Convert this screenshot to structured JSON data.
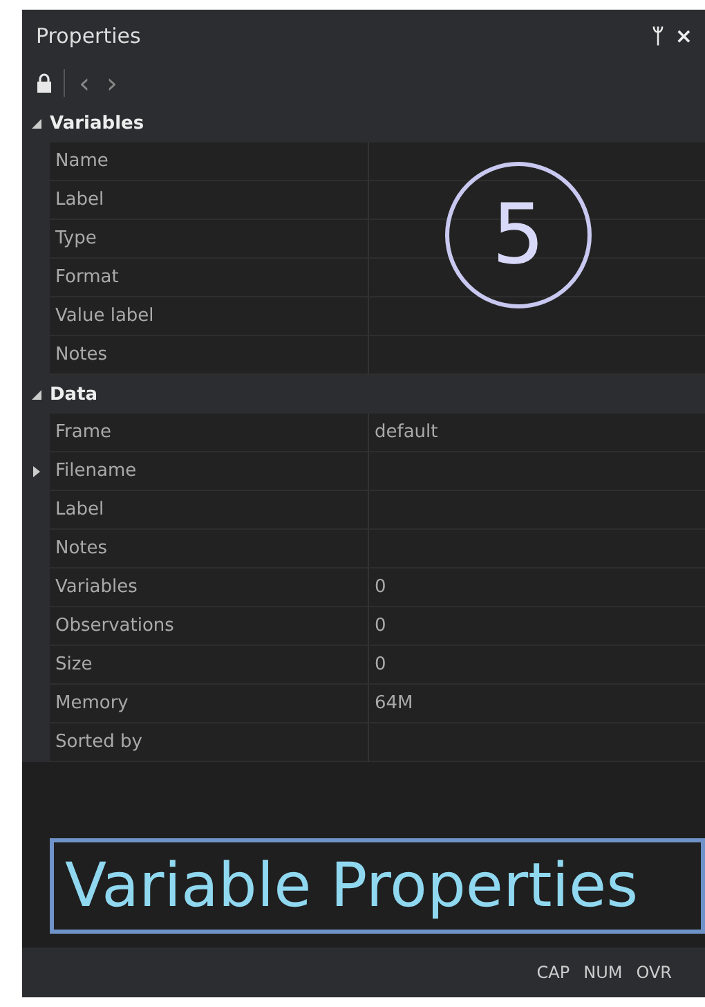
{
  "panel": {
    "title": "Properties",
    "pin": "ᛘ",
    "close": "×"
  },
  "toolbar": {
    "locked": true,
    "back": "‹",
    "forward": "›"
  },
  "groups": [
    {
      "name": "Variables",
      "expanded": true,
      "rows": [
        {
          "label": "Name",
          "value": "",
          "expandable": false
        },
        {
          "label": "Label",
          "value": "",
          "expandable": false
        },
        {
          "label": "Type",
          "value": "",
          "expandable": false
        },
        {
          "label": "Format",
          "value": "",
          "expandable": false
        },
        {
          "label": "Value label",
          "value": "",
          "expandable": false
        },
        {
          "label": "Notes",
          "value": "",
          "expandable": false
        }
      ]
    },
    {
      "name": "Data",
      "expanded": true,
      "rows": [
        {
          "label": "Frame",
          "value": "default",
          "expandable": false
        },
        {
          "label": "Filename",
          "value": "",
          "expandable": true
        },
        {
          "label": "Label",
          "value": "",
          "expandable": false
        },
        {
          "label": "Notes",
          "value": "",
          "expandable": false
        },
        {
          "label": "Variables",
          "value": "0",
          "expandable": false
        },
        {
          "label": "Observations",
          "value": "0",
          "expandable": false
        },
        {
          "label": "Size",
          "value": "0",
          "expandable": false
        },
        {
          "label": "Memory",
          "value": "64M",
          "expandable": false
        },
        {
          "label": "Sorted by",
          "value": "",
          "expandable": false
        }
      ]
    }
  ],
  "callout_number": "5",
  "caption": "Variable Properties",
  "status_bar": [
    "CAP",
    "NUM",
    "OVR"
  ]
}
